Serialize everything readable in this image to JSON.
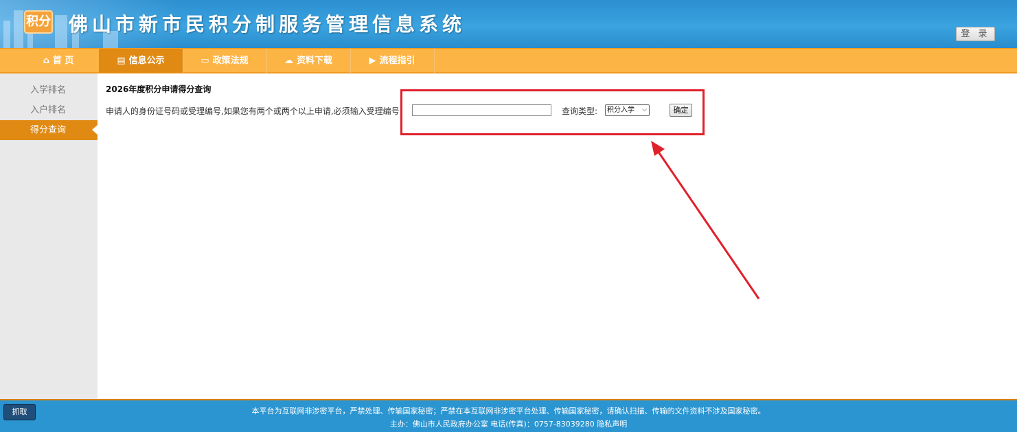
{
  "header": {
    "logo_text": "积分",
    "title": "佛山市新市民积分制服务管理信息系统",
    "login_label": "登 录"
  },
  "nav": {
    "items": [
      {
        "label": "首 页",
        "icon": "home-icon"
      },
      {
        "label": "信息公示",
        "icon": "notice-icon"
      },
      {
        "label": "政策法规",
        "icon": "policy-icon"
      },
      {
        "label": "资料下载",
        "icon": "cloud-download-icon"
      },
      {
        "label": "流程指引",
        "icon": "play-circle-icon"
      }
    ],
    "active_index": 1
  },
  "sidebar": {
    "items": [
      {
        "label": "入学排名"
      },
      {
        "label": "入户排名"
      },
      {
        "label": "得分查询"
      }
    ],
    "active_index": 2
  },
  "main": {
    "title": "2026年度积分申请得分查询",
    "query_label": "申请人的身份证号码或受理编号,如果您有两个或两个以上申请,必须输入受理编号:",
    "id_input_value": "",
    "type_label": "查询类型:",
    "type_selected": "积分入学",
    "confirm_label": "确定"
  },
  "footer": {
    "line1": "本平台为互联网非涉密平台，严禁处理、传输国家秘密；严禁在本互联网非涉密平台处理、传输国家秘密，请确认扫描、传输的文件资料不涉及国家秘密。",
    "line2": "主办：佛山市人民政府办公室    电话(传真)：0757-83039280    隐私声明"
  },
  "grab_button": "抓取",
  "colors": {
    "header_blue": "#2c8fd0",
    "nav_orange": "#fcb445",
    "active_orange": "#e08a14",
    "annotation_red": "#e0202a"
  }
}
